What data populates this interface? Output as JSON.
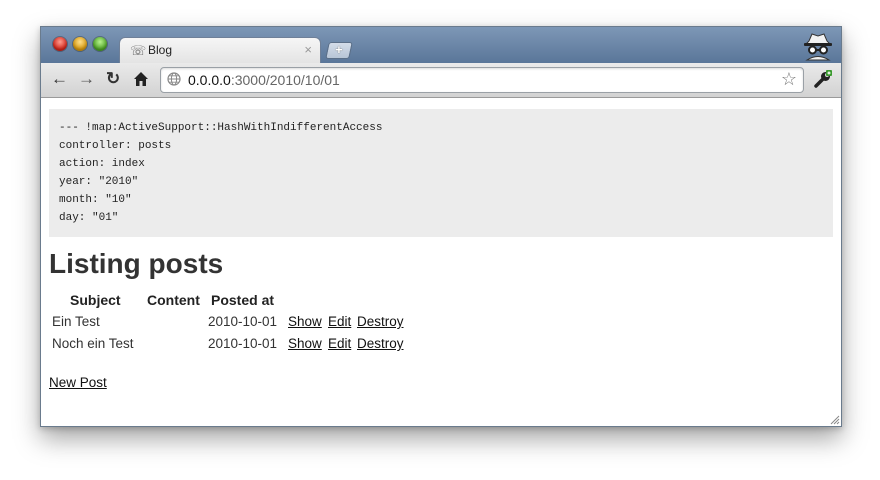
{
  "tab": {
    "title": "Blog",
    "close_label": "×"
  },
  "newtab": {
    "label": "+"
  },
  "address_bar": {
    "host": "0.0.0.0",
    "path": ":3000/2010/10/01"
  },
  "params_dump": [
    "--- !map:ActiveSupport::HashWithIndifferentAccess",
    "controller: posts",
    "action: index",
    "year: \"2010\"",
    "month: \"10\"",
    "day: \"01\""
  ],
  "heading": "Listing posts",
  "table": {
    "headers": [
      "Subject",
      "Content",
      "Posted at"
    ],
    "rows": [
      {
        "subject": "Ein Test",
        "content": "",
        "posted_at": "2010-10-01",
        "show": "Show",
        "edit": "Edit",
        "destroy": "Destroy"
      },
      {
        "subject": "Noch ein Test",
        "content": "",
        "posted_at": "2010-10-01",
        "show": "Show",
        "edit": "Edit",
        "destroy": "Destroy"
      }
    ]
  },
  "new_post_link": "New Post",
  "icons": {
    "back": "back-arrow-icon",
    "forward": "forward-arrow-icon",
    "reload": "reload-icon",
    "home": "home-icon",
    "globe": "globe-icon",
    "star": "bookmark-star-icon",
    "wrench": "wrench-icon",
    "incognito": "incognito-icon"
  },
  "colors": {
    "titlebar": "#6b86a8",
    "params_bg": "#ececec"
  }
}
